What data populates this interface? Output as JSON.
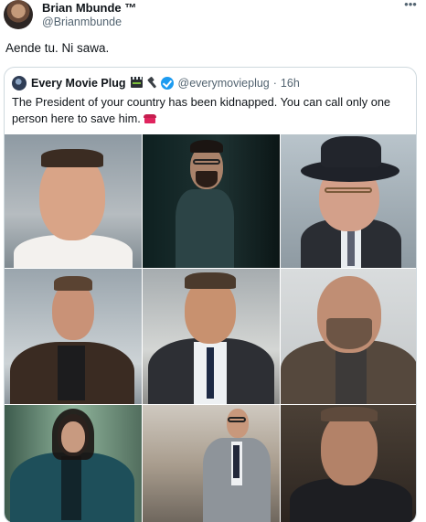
{
  "tweet": {
    "author_name": "Brian Mbunde ™",
    "author_handle": "@Brianmbunde",
    "text": "Aende tu. Ni sawa.",
    "more_icon": "more-horizontal-icon"
  },
  "quote": {
    "author_name": "Every Movie Plug",
    "author_handle": "@everymovieplug",
    "separator": "·",
    "time": "16h",
    "verified_color": "#1d9bf0",
    "text": "The President of your country has been kidnapped. You can call only one person here to save him.",
    "text_emoji": "telephone-icon"
  },
  "images": [
    {
      "name": "photo-1"
    },
    {
      "name": "photo-2"
    },
    {
      "name": "photo-3"
    },
    {
      "name": "photo-4"
    },
    {
      "name": "photo-5"
    },
    {
      "name": "photo-6"
    },
    {
      "name": "photo-7"
    },
    {
      "name": "photo-8"
    },
    {
      "name": "photo-9"
    }
  ],
  "colors": {
    "link_blue": "#1d9bf0",
    "secondary_text": "#536471",
    "border": "#cfd9de"
  }
}
